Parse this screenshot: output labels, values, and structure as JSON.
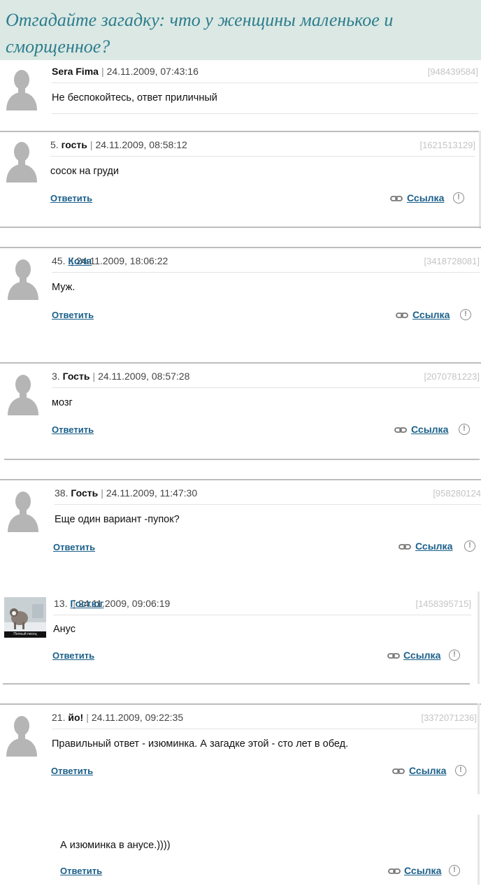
{
  "header": {
    "title": "Отгадайте загадку: что у женщины маленькое и сморщенное?"
  },
  "actions": {
    "reply": "Ответить",
    "link": "Ссылка",
    "warn": "!"
  },
  "comments": [
    {
      "num": "",
      "author": "Sera Fima",
      "datetime": "24.11.2009, 07:43:16",
      "id": "[948439584]",
      "text": "Не беспокойтесь, ответ приличный"
    },
    {
      "num": "5.",
      "author": "гость",
      "datetime": "24.11.2009, 08:58:12",
      "id": "[1621513129]",
      "text": "сосок на груди"
    },
    {
      "num": "45.",
      "author": "Коля",
      "datetime": "24.11.2009, 18:06:22",
      "id": "[3418728081]",
      "text": "Муж."
    },
    {
      "num": "3.",
      "author": "Гость",
      "datetime": "24.11.2009, 08:57:28",
      "id": "[2070781223]",
      "text": "мозг"
    },
    {
      "num": "38.",
      "author": "Гость",
      "datetime": "24.11.2009, 11:47:30",
      "id": "[958280124",
      "text": "Еще один вариант -пупок?"
    },
    {
      "num": "13.",
      "author": "Гостюг",
      "datetime": "24.11.2009, 09:06:19",
      "id": "[1458395715]",
      "text": "Анус",
      "avatar_caption": "Полный писец"
    },
    {
      "num": "21.",
      "author": "йо!",
      "datetime": "24.11.2009, 09:22:35",
      "id": "[3372071236]",
      "text": "Правильный ответ - изюминка. А загадке этой - сто лет в обед."
    },
    {
      "text": "А изюминка в анусе.))))"
    }
  ]
}
